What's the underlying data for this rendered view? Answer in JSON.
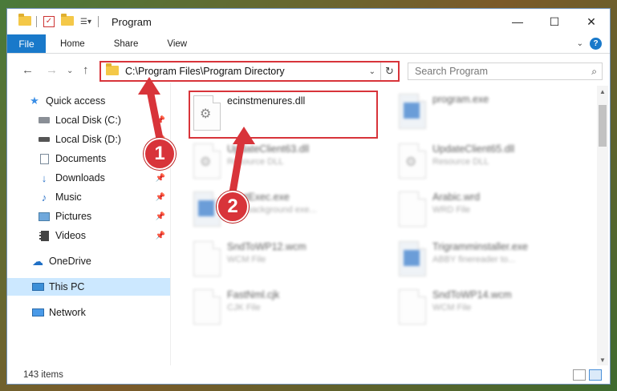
{
  "window": {
    "title": "Program",
    "controls": {
      "minimize": "—",
      "maximize": "☐",
      "close": "✕"
    }
  },
  "ribbon": {
    "tabs": [
      {
        "label": "File"
      },
      {
        "label": "Home"
      },
      {
        "label": "Share"
      },
      {
        "label": "View"
      }
    ]
  },
  "address": {
    "path": "C:\\Program Files\\Program Directory",
    "search_placeholder": "Search Program"
  },
  "sidebar": {
    "items": [
      {
        "label": "Quick access",
        "icon": "star-icon",
        "pinned": false
      },
      {
        "label": "Local Disk (C:)",
        "icon": "drive-icon",
        "pinned": true
      },
      {
        "label": "Local Disk (D:)",
        "icon": "drive-icon",
        "pinned": true
      },
      {
        "label": "Documents",
        "icon": "documents-icon",
        "pinned": true
      },
      {
        "label": "Downloads",
        "icon": "download-icon",
        "pinned": true
      },
      {
        "label": "Music",
        "icon": "music-icon",
        "pinned": true
      },
      {
        "label": "Pictures",
        "icon": "pictures-icon",
        "pinned": true
      },
      {
        "label": "Videos",
        "icon": "videos-icon",
        "pinned": true
      },
      {
        "label": "OneDrive",
        "icon": "cloud-icon",
        "pinned": false
      },
      {
        "label": "This PC",
        "icon": "pc-icon",
        "pinned": false,
        "selected": true
      },
      {
        "label": "Network",
        "icon": "network-icon",
        "pinned": false
      }
    ]
  },
  "files": [
    {
      "name": "ecinstmenures.dll",
      "type": "",
      "kind": "dll",
      "highlighted": true,
      "blurred": false
    },
    {
      "name": "program.exe",
      "type": "",
      "kind": "exe",
      "blurred": true
    },
    {
      "name": "UpdateClient63.dll",
      "type": "Resource DLL",
      "kind": "dll",
      "blurred": true
    },
    {
      "name": "UpdateClient65.dll",
      "type": "Resource DLL",
      "kind": "dll",
      "blurred": true
    },
    {
      "name": "StartExec.exe",
      "type": "SST background exe...",
      "kind": "exe",
      "blurred": true
    },
    {
      "name": "Arabic.wrd",
      "type": "WRD File",
      "kind": "doc",
      "blurred": true
    },
    {
      "name": "SndToWP12.wcm",
      "type": "WCM File",
      "kind": "doc",
      "blurred": true
    },
    {
      "name": "Trigramminstaller.exe",
      "type": "ABBY finereader to...",
      "kind": "exe",
      "blurred": true
    },
    {
      "name": "FastNml.cjk",
      "type": "CJK File",
      "kind": "doc",
      "blurred": true
    },
    {
      "name": "SndToWP14.wcm",
      "type": "WCM File",
      "kind": "doc",
      "blurred": true
    }
  ],
  "status": {
    "count": "143 items"
  },
  "callouts": [
    "1",
    "2"
  ],
  "colors": {
    "accent": "#1979ca",
    "highlight": "#d8343a",
    "selected": "#cce8ff"
  }
}
